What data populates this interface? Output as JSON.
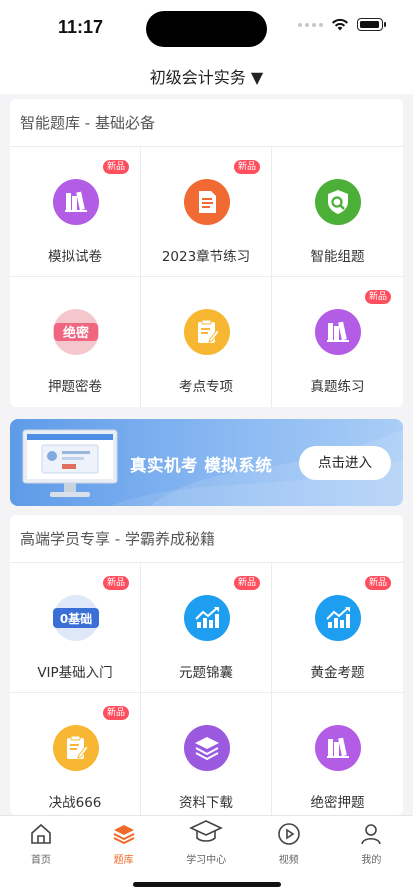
{
  "status": {
    "time": "11:17"
  },
  "header": {
    "title": "初级会计实务 ▼"
  },
  "section1": {
    "title": "智能题库 - 基础必备",
    "items": [
      {
        "label": "模拟试卷",
        "badge": "新品",
        "icon": "books-icon",
        "color": "#b35de6"
      },
      {
        "label": "2023章节练习",
        "badge": "新品",
        "icon": "document-icon",
        "color": "#f26a33"
      },
      {
        "label": "智能组题",
        "badge": "",
        "icon": "shield-search-icon",
        "color": "#4caf37"
      },
      {
        "label": "押题密卷",
        "badge": "",
        "icon": "secret-stamp-icon",
        "color": "#f06580",
        "stamp_text": "绝密"
      },
      {
        "label": "考点专项",
        "badge": "",
        "icon": "clipboard-edit-icon",
        "color": "#f7b733"
      },
      {
        "label": "真题练习",
        "badge": "新品",
        "icon": "books-icon",
        "color": "#b35de6"
      }
    ]
  },
  "banner": {
    "text": "真实机考 模拟系统",
    "button": "点击进入"
  },
  "section2": {
    "title": "高端学员专享 - 学霸养成秘籍",
    "items": [
      {
        "label": "VIP基础入门",
        "badge": "新品",
        "icon": "zero-basics-icon",
        "color": "#3a6fd8",
        "stamp_text": "0基础"
      },
      {
        "label": "元题锦囊",
        "badge": "新品",
        "icon": "chart-up-icon",
        "color": "#1e9ef0"
      },
      {
        "label": "黄金考题",
        "badge": "新品",
        "icon": "chart-up-icon",
        "color": "#1e9ef0"
      },
      {
        "label": "决战666",
        "badge": "新品",
        "icon": "clipboard-edit-icon",
        "color": "#f7b733"
      },
      {
        "label": "资料下载",
        "badge": "",
        "icon": "layers-icon",
        "color": "#9b59e0"
      },
      {
        "label": "绝密押题",
        "badge": "",
        "icon": "books-icon",
        "color": "#b35de6"
      }
    ]
  },
  "tabs": [
    {
      "label": "首页",
      "icon": "home-icon",
      "active": false
    },
    {
      "label": "题库",
      "icon": "stack-icon",
      "active": true
    },
    {
      "label": "学习中心",
      "icon": "graduation-cap-icon",
      "active": false
    },
    {
      "label": "视频",
      "icon": "play-icon",
      "active": false
    },
    {
      "label": "我的",
      "icon": "user-icon",
      "active": false
    }
  ],
  "colors": {
    "accent": "#ee6a2a",
    "badge": "#ff4f5e",
    "banner": "#6aa4ec"
  }
}
